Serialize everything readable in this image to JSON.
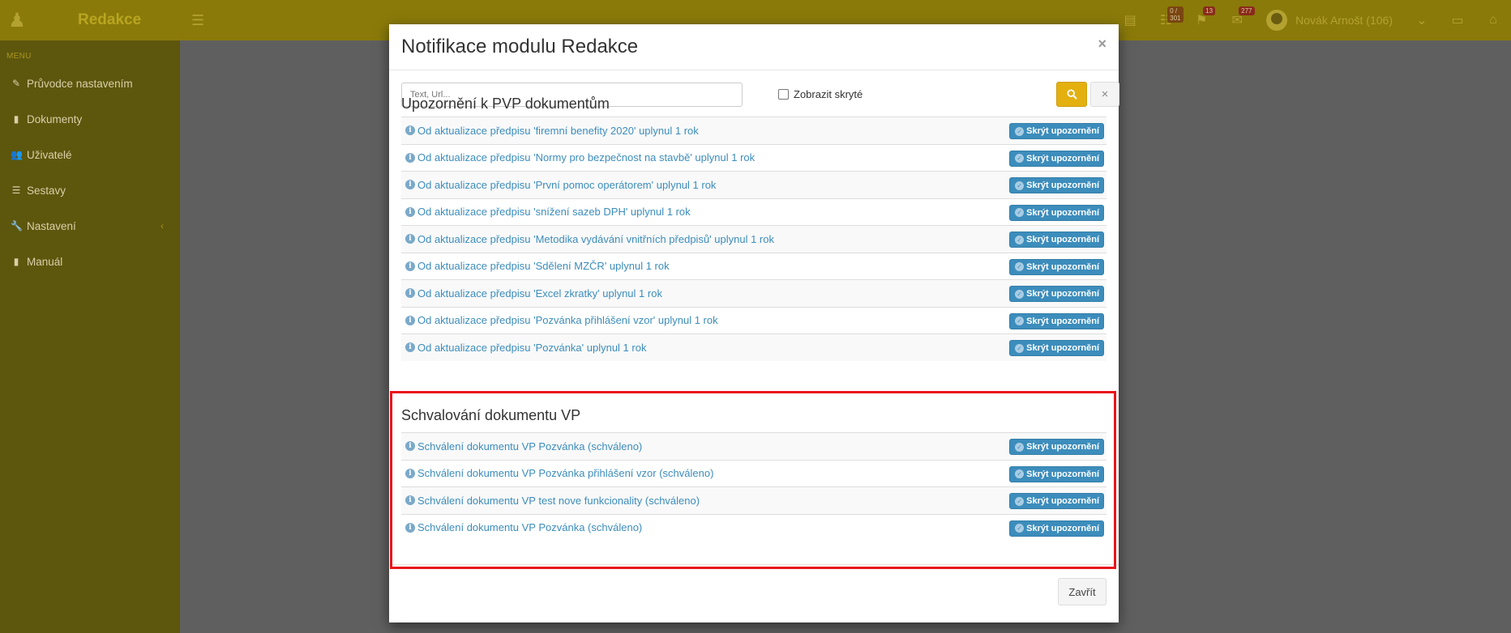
{
  "app": {
    "brand": "Redakce",
    "user_name": "Novák Arnošt (106)",
    "badges": [
      "0 / 301",
      "13",
      "277"
    ]
  },
  "sidebar": {
    "menu_header": "MENU",
    "items": [
      {
        "label": "Průvodce nastavením",
        "icon": "pencil-icon"
      },
      {
        "label": "Dokumenty",
        "icon": "book-icon"
      },
      {
        "label": "Uživatelé",
        "icon": "users-icon"
      },
      {
        "label": "Sestavy",
        "icon": "list-icon"
      },
      {
        "label": "Nastavení",
        "icon": "wrench-icon"
      },
      {
        "label": "Manuál",
        "icon": "book-icon"
      }
    ]
  },
  "modal": {
    "title": "Notifikace modulu Redakce",
    "close_symbol": "×",
    "search_placeholder": "Text, Url...",
    "show_hidden_label": "Zobrazit skryté",
    "clear_symbol": "×",
    "footer_close_label": "Zavřít",
    "hide_label": "Skrýt upozornění",
    "sections": [
      {
        "title": "Upozornění k PVP dokumentům",
        "items": [
          "Od aktualizace předpisu 'firemní benefity 2020' uplynul 1 rok",
          "Od aktualizace předpisu 'Normy pro bezpečnost na stavbě' uplynul 1 rok",
          "Od aktualizace předpisu 'První pomoc operátorem' uplynul 1 rok",
          "Od aktualizace předpisu 'snížení sazeb DPH' uplynul 1 rok",
          "Od aktualizace předpisu 'Metodika vydávání vnitřních předpisů' uplynul 1 rok",
          "Od aktualizace předpisu 'Sdělení MZČR' uplynul 1 rok",
          "Od aktualizace předpisu 'Excel zkratky' uplynul 1 rok",
          "Od aktualizace předpisu 'Pozvánka přihlášení vzor' uplynul 1 rok",
          "Od aktualizace předpisu 'Pozvánka' uplynul 1 rok"
        ]
      },
      {
        "title": "Schvalování dokumentu VP",
        "items": [
          "Schválení dokumentu VP Pozvánka (schváleno)",
          "Schválení dokumentu VP Pozvánka přihlášení vzor (schváleno)",
          "Schválení dokumentu VP test nove funkcionality (schváleno)",
          "Schválení dokumentu VP Pozvánka (schváleno)"
        ]
      }
    ]
  },
  "colors": {
    "accent": "#e3b010",
    "link": "#3c8dbc",
    "highlight": "#e8141c"
  }
}
